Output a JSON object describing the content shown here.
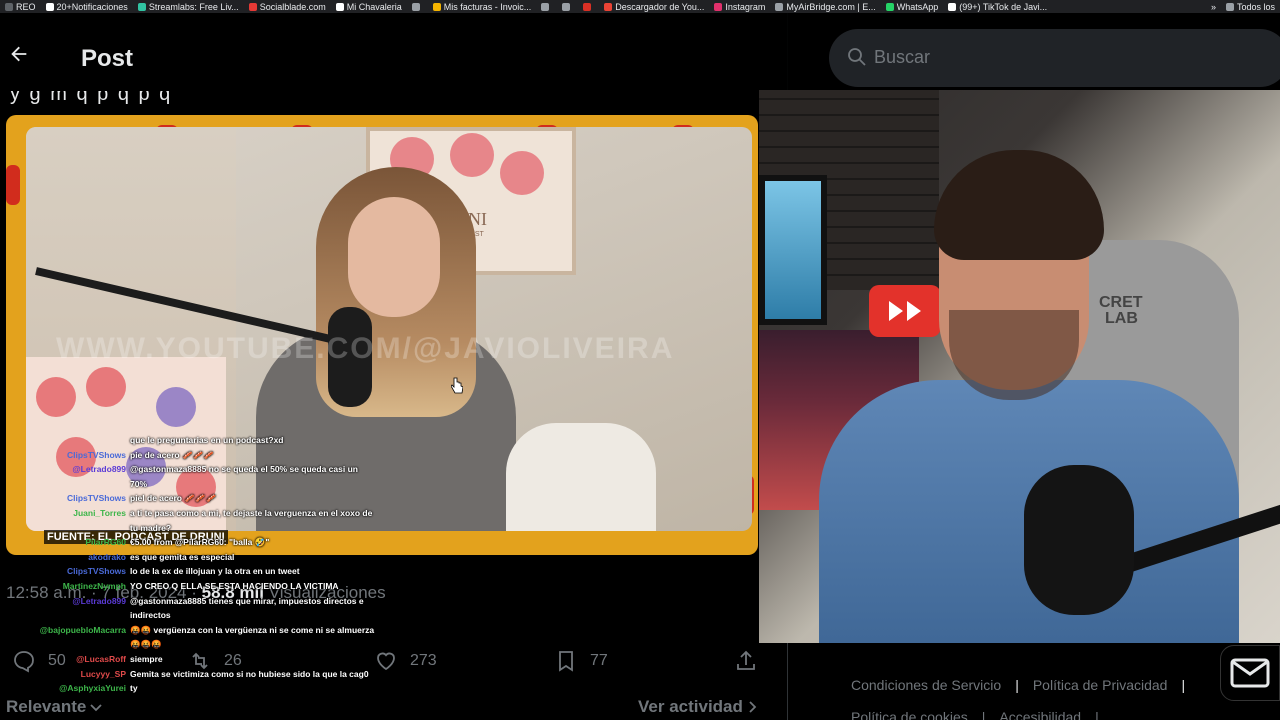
{
  "bookmarks": [
    {
      "label": "REO",
      "color": "#5f6368"
    },
    {
      "label": "20+Notificaciones",
      "color": "#ffffff"
    },
    {
      "label": "Streamlabs: Free Liv...",
      "color": "#31c3a2"
    },
    {
      "label": "Socialblade.com",
      "color": "#e53935"
    },
    {
      "label": "Mi Chavaleria",
      "color": "#ffffff"
    },
    {
      "label": "",
      "color": "#9aa0a6"
    },
    {
      "label": "Mis facturas - Invoic...",
      "color": "#f4b400"
    },
    {
      "label": "",
      "color": "#9aa0a6"
    },
    {
      "label": "",
      "color": "#9aa0a6"
    },
    {
      "label": "",
      "color": "#d93025"
    },
    {
      "label": "Descargador de You...",
      "color": "#ea4335"
    },
    {
      "label": "Instagram",
      "color": "#e1306c"
    },
    {
      "label": "MyAirBridge.com | E...",
      "color": "#9aa0a6"
    },
    {
      "label": "WhatsApp",
      "color": "#25d366"
    },
    {
      "label": "(99+) TikTok de Javi...",
      "color": "#ffffff"
    }
  ],
  "bookmarks_more": "»",
  "bookmarks_all": "Todos los",
  "header": {
    "title": "Post"
  },
  "tweet_text_fragment": "     y  g               m  q  p     q  p     q",
  "video": {
    "poster_title": "DRUNI",
    "poster_subtitle": "PODCAST",
    "watermark": "WWW.YOUTUBE.COM/@JAVIOLIVEIRA",
    "source_caption": "FUENTE: EL PODCAST DE DRUNI"
  },
  "meta": {
    "time_date": "12:58 a.m. · 7 feb. 2024 · ",
    "views_count": "58.8 mil",
    "views_label": "Visualizaciones"
  },
  "actions": {
    "replies": "50",
    "reposts": "26",
    "likes": "273",
    "bookmarks": "77"
  },
  "sort": {
    "label": "Relevante"
  },
  "activity": {
    "label": "Ver actividad"
  },
  "chat": [
    {
      "user": "",
      "color": "#ffffff",
      "msg": "que le preguntarias en un podcast?xd"
    },
    {
      "user": "ClipsTVShows",
      "color": "#4a6ad8",
      "msg": "pie de acero 🥓🥓🥓"
    },
    {
      "user": "@Letrado899",
      "color": "#5b3bd6",
      "msg": "@gastonmaza8885 no se queda el 50% se queda casi un 70%"
    },
    {
      "user": "ClipsTVShows",
      "color": "#4a6ad8",
      "msg": "piel de acero 🥓🥓🥓"
    },
    {
      "user": "Juani_Torres",
      "color": "#3db54a",
      "msg": "a ti te pasa como a mi, te dejaste la verguenza en el xoxo de tu madre?"
    },
    {
      "user": "PilarRG60",
      "color": "#3db54a",
      "msg": "€5.00 from @PilarRG60: \"balla 🤣\""
    },
    {
      "user": "akodrako",
      "color": "#4a6ad8",
      "msg": "es que gemita es especial"
    },
    {
      "user": "ClipsTVShows",
      "color": "#4a6ad8",
      "msg": "lo de la ex de illojuan y la otra en un tweet"
    },
    {
      "user": "MartinezNymph",
      "color": "#3db54a",
      "msg": "YO CREO Q ELLA SE ESTA HACIENDO LA VICTIMA"
    },
    {
      "user": "@Letrado899",
      "color": "#5b3bd6",
      "msg": "@gastonmaza8885 tienes que mirar, impuestos directos e indirectos"
    },
    {
      "user": "@bajopuebloMacarra",
      "color": "#3db54a",
      "msg": "🤬🤬 vergüenza con la vergüenza ni se come ni se almuerza 🤬🤬🤬"
    },
    {
      "user": "@LucasRoff",
      "color": "#e04a4a",
      "msg": "siempre"
    },
    {
      "user": "Lucyyy_SP",
      "color": "#e04a4a",
      "msg": "Gemita se victimiza como si no hubiese sido la que la cag0"
    },
    {
      "user": "@AsphyxiaYurei",
      "color": "#3db54a",
      "msg": "ty"
    }
  ],
  "search": {
    "placeholder": "Buscar"
  },
  "webcam": {
    "chair_brand_line1": "CRET",
    "chair_brand_line2": "LAB"
  },
  "footer": {
    "links_row1": [
      "Condiciones de Servicio",
      "Política de Privacidad"
    ],
    "links_row2": [
      "Política de cookies",
      "Accesibilidad"
    ],
    "separator": "|"
  },
  "colors": {
    "accent": "#1d9bf0",
    "muted": "#71767b",
    "frame": "#e3a21d"
  }
}
